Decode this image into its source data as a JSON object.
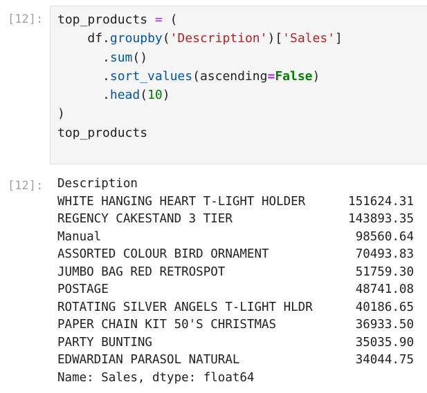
{
  "input_cell": {
    "prompt": "[12]:",
    "code": {
      "var": "top_products",
      "assign": "=",
      "open_paren": "(",
      "df": "df",
      "dot1": ".",
      "groupby": "groupby",
      "groupby_open": "(",
      "groupby_arg": "'Description'",
      "groupby_close": ")",
      "index_open": "[",
      "index_arg": "'Sales'",
      "index_close": "]",
      "dot2": ".",
      "sum": "sum",
      "sum_parens": "()",
      "dot3": ".",
      "sort_values": "sort_values",
      "sort_open": "(",
      "kwarg_name": "ascending",
      "kwarg_eq": "=",
      "kwarg_val": "False",
      "sort_close": ")",
      "dot4": ".",
      "head": "head",
      "head_open": "(",
      "head_arg": "10",
      "head_close": ")",
      "close_paren": ")",
      "last_expr": "top_products"
    }
  },
  "output_cell": {
    "prompt": "[12]:",
    "index_name": "Description",
    "rows": [
      {
        "description": "WHITE HANGING HEART T-LIGHT HOLDER",
        "value": "151624.31"
      },
      {
        "description": "REGENCY CAKESTAND 3 TIER",
        "value": "143893.35"
      },
      {
        "description": "Manual",
        "value": "98560.64"
      },
      {
        "description": "ASSORTED COLOUR BIRD ORNAMENT",
        "value": "70493.83"
      },
      {
        "description": "JUMBO BAG RED RETROSPOT",
        "value": "51759.30"
      },
      {
        "description": "POSTAGE",
        "value": "48741.08"
      },
      {
        "description": "ROTATING SILVER ANGELS T-LIGHT HLDR",
        "value": "40186.65"
      },
      {
        "description": "PAPER CHAIN KIT 50'S CHRISTMAS",
        "value": "36933.50"
      },
      {
        "description": "PARTY BUNTING",
        "value": "35035.90"
      },
      {
        "description": "EDWARDIAN PARASOL NATURAL",
        "value": "34044.75"
      }
    ],
    "footer": "Name: Sales, dtype: float64"
  }
}
